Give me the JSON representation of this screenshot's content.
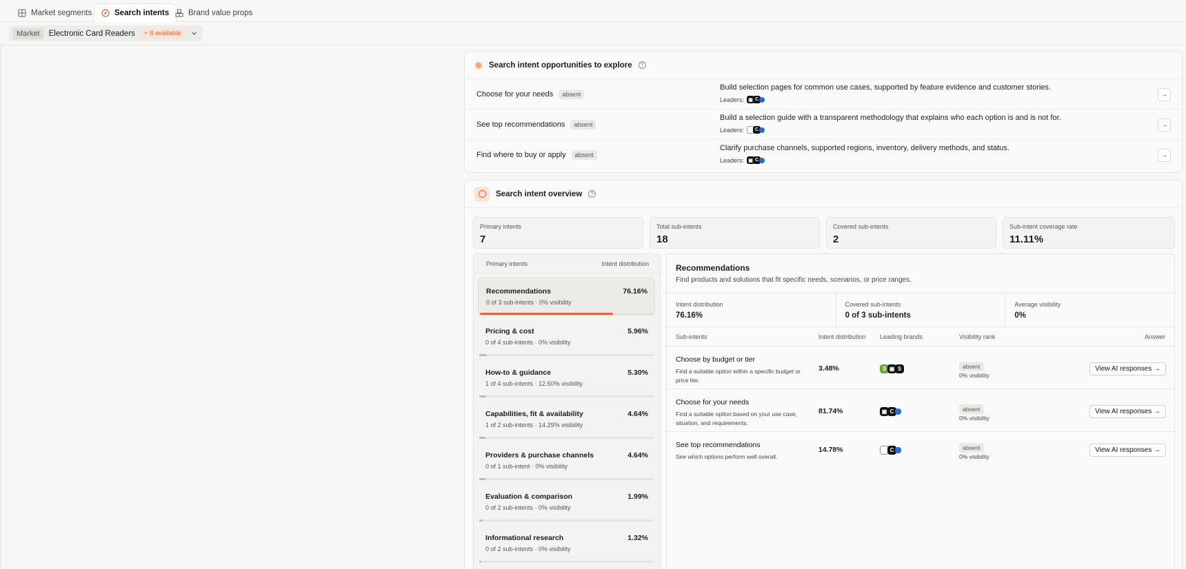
{
  "tabs": [
    {
      "label": "Market segments",
      "icon": "grid-icon"
    },
    {
      "label": "Search intents",
      "icon": "compass-icon"
    },
    {
      "label": "Brand value props",
      "icon": "cubes-icon"
    }
  ],
  "market": {
    "tag": "Market",
    "name": "Electronic Card Readers",
    "available": "+ 8 available"
  },
  "opportunities": {
    "title": "Search intent opportunities to explore",
    "leaders_label": "Leaders:",
    "rows": [
      {
        "name": "Choose for your needs",
        "status": "absent",
        "description": "Build selection pages for common use cases, supported by feature evidence and customer stories."
      },
      {
        "name": "See top recommendations",
        "status": "absent",
        "description": "Build a selection guide with a transparent methodology that explains who each option is and is not for."
      },
      {
        "name": "Find where to buy or apply",
        "status": "absent",
        "description": "Clarify purchase channels, supported regions, inventory, delivery methods, and status."
      }
    ]
  },
  "overview": {
    "title": "Search intent overview",
    "stats": [
      {
        "label": "Primary intents",
        "value": "7"
      },
      {
        "label": "Total sub-intents",
        "value": "18"
      },
      {
        "label": "Covered sub-intents",
        "value": "2"
      },
      {
        "label": "Sub-intent coverage rate",
        "value": "11.11%"
      }
    ],
    "list_header": {
      "left": "Primary intents",
      "right": "Intent distribution"
    },
    "primary_intents": [
      {
        "name": "Recommendations",
        "pct": "76.16%",
        "sub": "0 of 3 sub-intents · 0% visibility",
        "share": 0.7616
      },
      {
        "name": "Pricing & cost",
        "pct": "5.96%",
        "sub": "0 of 4 sub-intents · 0% visibility",
        "share": 0.0596
      },
      {
        "name": "How-to & guidance",
        "pct": "5.30%",
        "sub": "1 of 4 sub-intents · 12.50% visibility",
        "share": 0.053
      },
      {
        "name": "Capabilities, fit & availability",
        "pct": "4.64%",
        "sub": "1 of 2 sub-intents · 14.29% visibility",
        "share": 0.0464
      },
      {
        "name": "Providers & purchase channels",
        "pct": "4.64%",
        "sub": "0 of 1 sub-intent · 0% visibility",
        "share": 0.0464
      },
      {
        "name": "Evaluation & comparison",
        "pct": "1.99%",
        "sub": "0 of 2 sub-intents · 0% visibility",
        "share": 0.0199
      },
      {
        "name": "Informational research",
        "pct": "1.32%",
        "sub": "0 of 2 sub-intents · 0% visibility",
        "share": 0.0132
      }
    ],
    "detail": {
      "title": "Recommendations",
      "description": "Find products and solutions that fit specific needs, scenarios, or price ranges.",
      "stats": [
        {
          "label": "Intent distribution",
          "value": "76.16%"
        },
        {
          "label": "Covered sub-intents",
          "value": "0 of 3 sub-intents"
        },
        {
          "label": "Average visibility",
          "value": "0%"
        }
      ],
      "columns": {
        "sub": "Sub-intents",
        "dist": "Intent distribution",
        "brands": "Leading brands",
        "rank": "Visibility rank",
        "answer": "Answer"
      },
      "rows": [
        {
          "name": "Choose by budget or tier",
          "description": "Find a suitable option within a specific budget or price tier.",
          "dist": "3.48%",
          "rank": "absent",
          "visibility": "0% visibility",
          "button": "View AI responses →"
        },
        {
          "name": "Choose for your needs",
          "description": "Find a suitable option based on your use case, situation, and requirements.",
          "dist": "81.74%",
          "rank": "absent",
          "visibility": "0% visibility",
          "button": "View AI responses →"
        },
        {
          "name": "See top recommendations",
          "description": "See which options perform well overall.",
          "dist": "14.78%",
          "rank": "absent",
          "visibility": "0% visibility",
          "button": "View AI responses →"
        }
      ]
    }
  },
  "colors": {
    "accent": "#e0683a",
    "accent_soft": "#fbe3d6",
    "paypal": "#1f6fd6",
    "shopify": "#6aa83c"
  }
}
